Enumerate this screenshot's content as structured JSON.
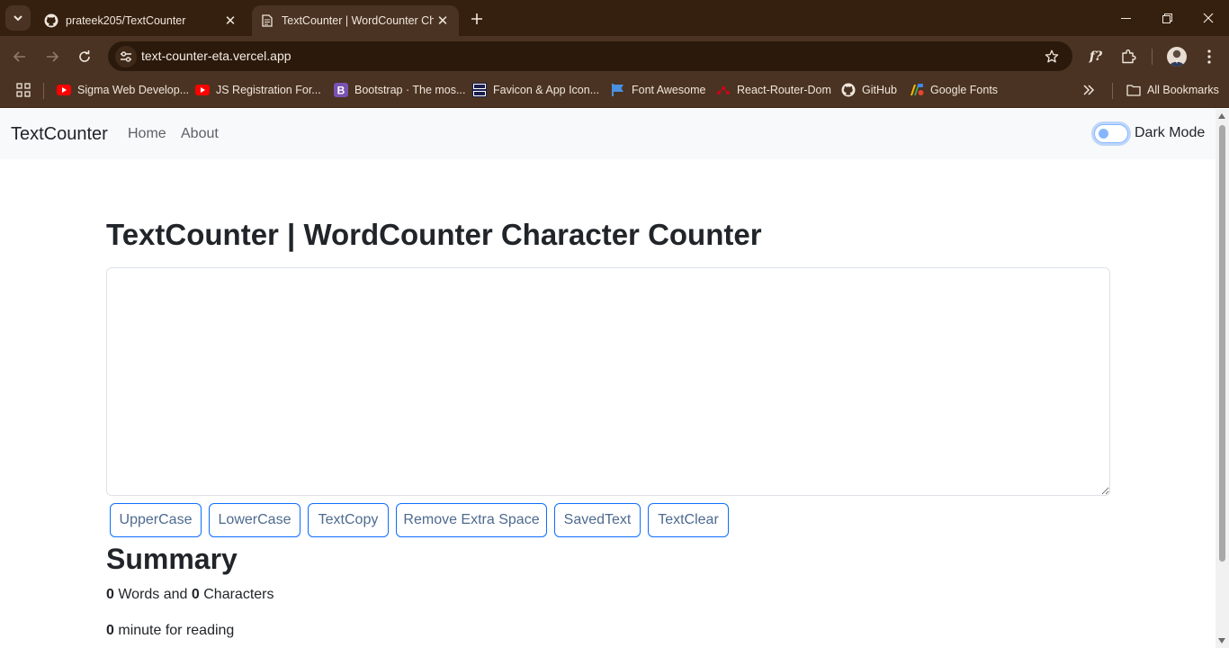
{
  "browser": {
    "tabs": [
      {
        "title": "prateek205/TextCounter",
        "active": false,
        "icon": "github-icon"
      },
      {
        "title": "TextCounter | WordCounter Character Counter",
        "active": true,
        "icon": "page-icon"
      }
    ],
    "url": "text-counter-eta.vercel.app",
    "bookmarks": [
      {
        "label": "Sigma Web Develop...",
        "icon": "youtube-icon"
      },
      {
        "label": "JS Registration For...",
        "icon": "youtube-icon"
      },
      {
        "label": "Bootstrap · The mos...",
        "icon": "bootstrap-icon"
      },
      {
        "label": "Favicon & App Icon...",
        "icon": "dans-tools-icon"
      },
      {
        "label": "Font Awesome",
        "icon": "flag-icon"
      },
      {
        "label": "React-Router-Dom",
        "icon": "router-icon"
      },
      {
        "label": "GitHub",
        "icon": "github-icon"
      },
      {
        "label": "Google Fonts",
        "icon": "google-fonts-icon"
      }
    ],
    "all_bookmarks": "All Bookmarks",
    "colors": {
      "chrome_dark": "#35200f",
      "chrome": "#4a3322"
    }
  },
  "app": {
    "brand": "TextCounter",
    "nav": [
      {
        "label": "Home"
      },
      {
        "label": "About"
      }
    ],
    "dark_mode_label": "Dark Mode",
    "dark_mode_on": false,
    "heading": "TextCounter | WordCounter Character Counter",
    "textarea_value": "",
    "buttons": [
      {
        "label": "UpperCase"
      },
      {
        "label": "LowerCase"
      },
      {
        "label": "TextCopy"
      },
      {
        "label": "Remove Extra Space"
      },
      {
        "label": "SavedText"
      },
      {
        "label": "TextClear"
      }
    ],
    "summary": {
      "title": "Summary",
      "words": "0",
      "words_label": "Words and",
      "characters": "0",
      "characters_label": "Characters",
      "minutes": "0",
      "minutes_label": "minute for reading"
    },
    "colors": {
      "primary": "#0d6efd",
      "navbar_bg": "#f8f9fa"
    }
  }
}
